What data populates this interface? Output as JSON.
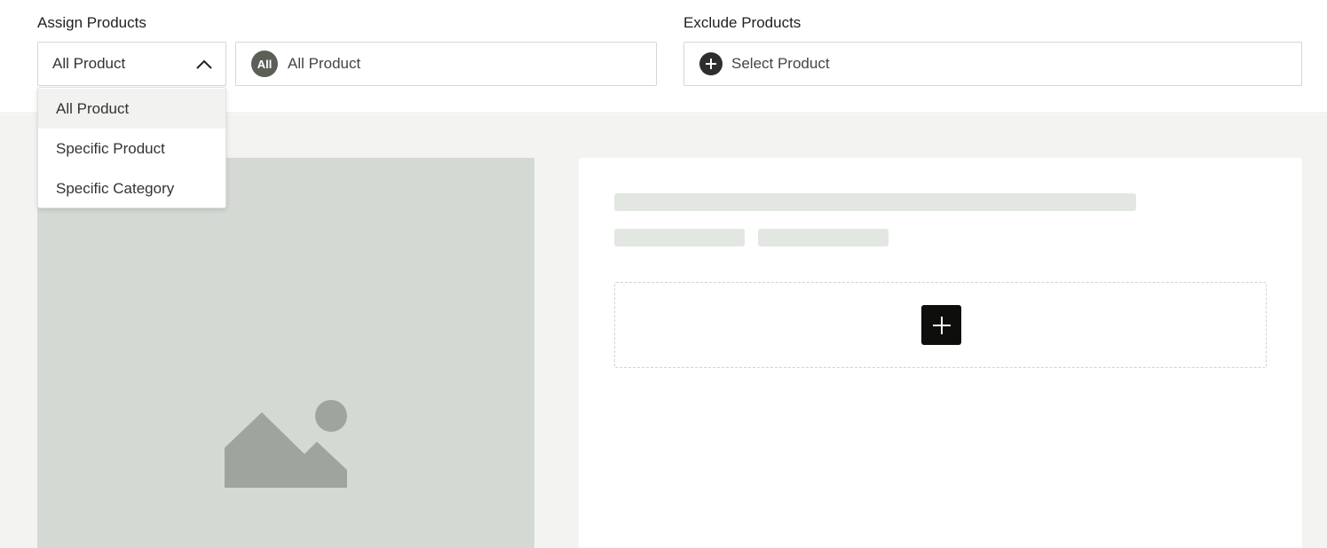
{
  "assign": {
    "label": "Assign Products",
    "selected": "All Product",
    "options": [
      "All Product",
      "Specific Product",
      "Specific Category"
    ],
    "tag_badge": "All",
    "tag_text": "All Product"
  },
  "exclude": {
    "label": "Exclude Products",
    "placeholder": "Select Product"
  },
  "icons": {
    "dropdown_toggle": "chevron-up-icon",
    "exclude_add": "plus-circle-icon",
    "image_placeholder": "image-icon",
    "add": "plus-icon"
  },
  "colors": {
    "badge": "#5a5f58",
    "add_button": "#0e0f0c",
    "placeholder_bg": "#d5d9d4",
    "skeleton": "#e3e7e2"
  }
}
